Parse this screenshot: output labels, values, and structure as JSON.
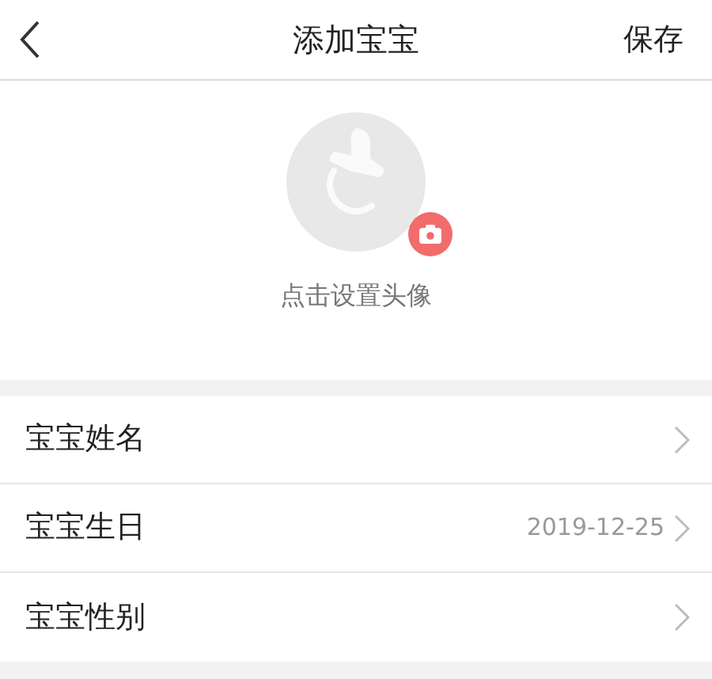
{
  "header": {
    "title": "添加宝宝",
    "action": "保存"
  },
  "avatar": {
    "hint": "点击设置头像"
  },
  "fields": [
    {
      "label": "宝宝姓名"
    },
    {
      "label": "宝宝生日",
      "value": "2019-12-25"
    },
    {
      "label": "宝宝性别"
    }
  ]
}
